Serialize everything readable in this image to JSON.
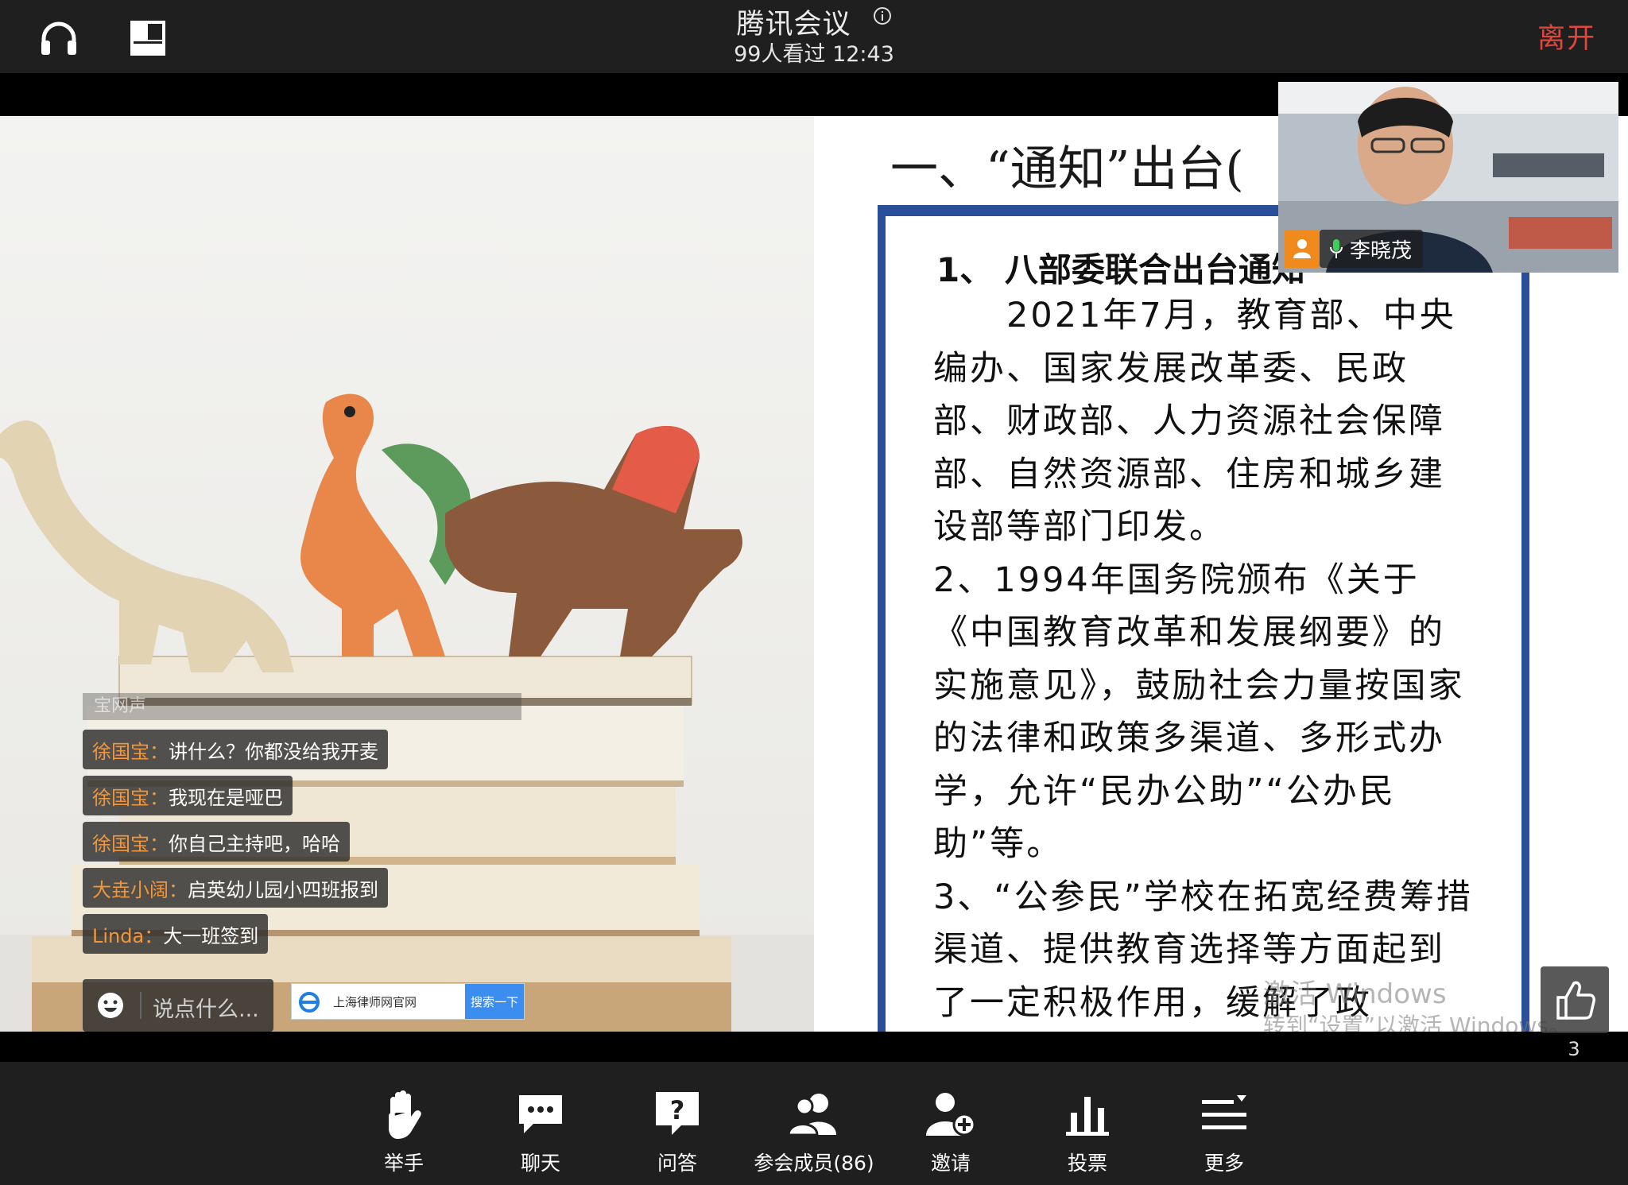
{
  "header": {
    "title": "腾讯会议",
    "subtitle": "99人看过  12:43",
    "leave_label": "离开",
    "accent": "#e0463b"
  },
  "slide": {
    "title": "一、“通知”出台(",
    "heading": "1、  八部委联合出台通知",
    "paragraphs": [
      "　　2021年7月，教育部、中央编办、国家发展改革委、民政部、财政部、人力资源社会保障部、自然资源部、住房和城乡建设部等部门印发。",
      "2、1994年国务院颁布《关于《中国教育改革和发展纲要》的实施意见》，鼓励社会力量按国家的法律和政策多渠道、多形式办学，允许“民办公助”“公办民助”等。",
      "3、“公参民”学校在拓宽经费筹措渠道、提供教育选择等方面起到了一定积极作用，缓解了政"
    ],
    "watermark_line1": "激活 Windows",
    "watermark_line2": "转到“设置”以激活 Windows。",
    "frame_color": "#2a4f9a"
  },
  "video": {
    "participant_name": "李晓茂"
  },
  "chat": {
    "faded_line": "宝网声",
    "messages": [
      {
        "name": "徐国宝：",
        "text": "讲什么？你都没给我开麦"
      },
      {
        "name": "徐国宝：",
        "text": "我现在是哑巴"
      },
      {
        "name": "徐国宝：",
        "text": "你自己主持吧，哈哈"
      },
      {
        "name": "大垚小阔：",
        "text": "启英幼儿园小四班报到"
      },
      {
        "name": "Linda：",
        "text": "大一班签到"
      }
    ],
    "input_placeholder": "说点什么..."
  },
  "ad": {
    "text": "上海律师网官网",
    "button": "搜索一下"
  },
  "like": {
    "count": "3"
  },
  "toolbar": {
    "items": [
      {
        "label": "举手",
        "icon": "hand-icon"
      },
      {
        "label": "聊天",
        "icon": "chat-icon"
      },
      {
        "label": "问答",
        "icon": "question-icon"
      },
      {
        "label": "参会成员(86)",
        "icon": "members-icon"
      },
      {
        "label": "邀请",
        "icon": "invite-icon"
      },
      {
        "label": "投票",
        "icon": "vote-icon"
      },
      {
        "label": "更多",
        "icon": "more-icon"
      }
    ]
  }
}
